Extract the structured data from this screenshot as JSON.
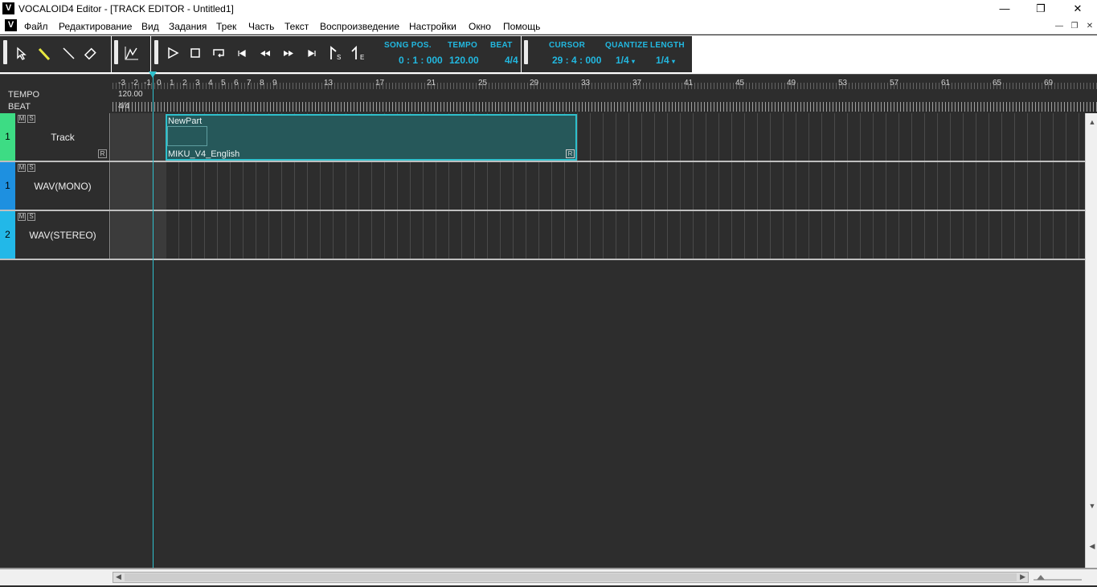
{
  "window": {
    "app_icon": "V",
    "title": "VOCALOID4 Editor - [TRACK EDITOR - Untitled1]",
    "minimize": "—",
    "restore": "❐",
    "close": "✕"
  },
  "menubar": {
    "icon": "V",
    "items": [
      "Файл",
      "Редактирование",
      "Вид",
      "Задания",
      "Трек",
      "Часть",
      "Текст",
      "Воспроизведение",
      "Настройки",
      "Окно",
      "Помощь"
    ]
  },
  "toolbar": {
    "tools": [
      "pointer-arrow-icon",
      "pencil-icon",
      "line-icon",
      "eraser-icon"
    ],
    "song_pos_label": "SONG POS.",
    "song_pos_value": "0 : 1 : 000",
    "tempo_label": "TEMPO",
    "tempo_value": "120.00",
    "beat_label": "BEAT",
    "beat_value": "4/4",
    "cursor_label": "CURSOR",
    "cursor_value": "29 : 4 : 000",
    "quantize_label": "QUANTIZE",
    "quantize_value": "1/4",
    "length_label": "LENGTH",
    "length_value": "1/4"
  },
  "ruler": {
    "tempo_label": "TEMPO",
    "beat_label": "BEAT",
    "tempo_value": "120.00",
    "beat_value": "4/4",
    "measures": [
      "-3",
      "-2",
      "-1",
      "0",
      "1",
      "2",
      "3",
      "4",
      "5",
      "6",
      "7",
      "8",
      "9",
      "13",
      "17",
      "21",
      "25",
      "29",
      "33",
      "37",
      "41",
      "45",
      "49",
      "53",
      "57",
      "61",
      "65",
      "69"
    ]
  },
  "tracks": [
    {
      "number": "1",
      "name": "Track",
      "color": "#3ddc84",
      "mute": "M",
      "solo": "S",
      "rec": "R"
    },
    {
      "number": "1",
      "name": "WAV(MONO)",
      "color": "#1e90e0",
      "mute": "M",
      "solo": "S"
    },
    {
      "number": "2",
      "name": "WAV(STEREO)",
      "color": "#22b8e8",
      "mute": "M",
      "solo": "S"
    }
  ],
  "part": {
    "name": "NewPart",
    "voice": "MIKU_V4_English",
    "rec": "R"
  }
}
